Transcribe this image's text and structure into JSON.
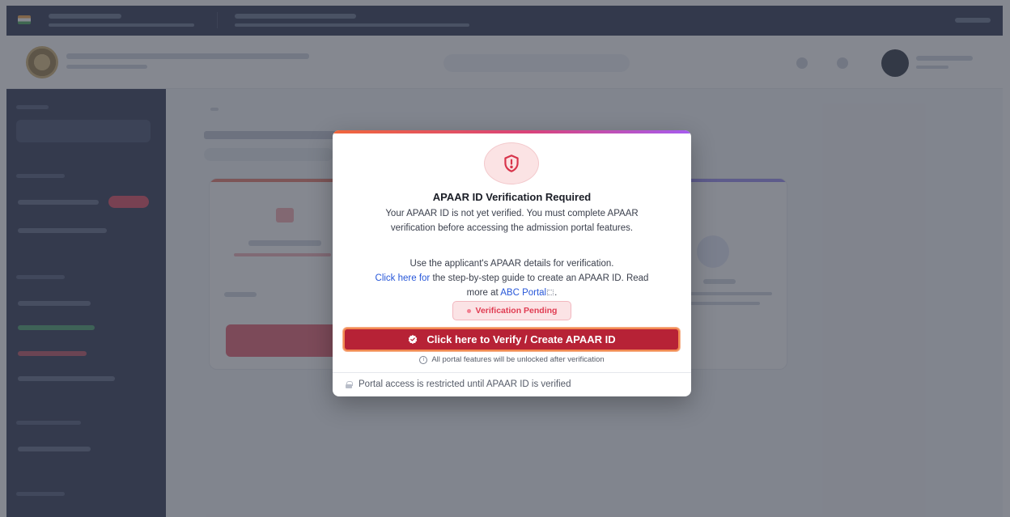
{
  "modal": {
    "title": "APAAR ID Verification Required",
    "message": "Your APAAR ID is not yet verified. You must complete APAAR verification before accessing the admission portal features.",
    "instruction": "Use the applicant's APAAR details for verification.",
    "guide_link": "Click here for",
    "guide_text": " the step-by-step guide to create an APAAR ID. Read more at ",
    "abc_link": "ABC Portal",
    "abc_suffix": ".",
    "status_badge": "Verification Pending",
    "primary_button": "Click here to Verify / Create APAAR ID",
    "unlock_note": "All portal features will be unlocked after verification",
    "footer_note": "Portal access is restricted until APAAR ID is verified"
  },
  "colors": {
    "primary_button": "#b72236",
    "status_text": "#e03c52",
    "link": "#2757d9",
    "sidebar": "#131c3b"
  },
  "icons": {
    "modal": "shield-alert-icon",
    "button": "badge-check-icon",
    "unlock": "info-icon",
    "footer": "lock-icon"
  }
}
